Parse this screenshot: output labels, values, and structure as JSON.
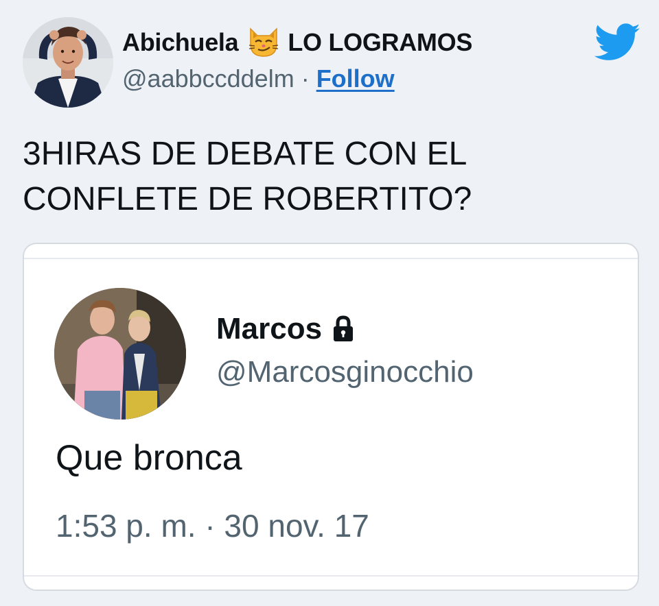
{
  "author": {
    "display_name": "Abichuela",
    "name_emoji": "smirking-cat-emoji",
    "display_name_suffix": "LO LOGRAMOS",
    "handle": "@aabbccddelm",
    "separator": "·",
    "follow_label": "Follow"
  },
  "tweet": {
    "text": "3HIRAS DE DEBATE CON EL\nCONFLETE DE ROBERTITO?"
  },
  "quoted_tweet": {
    "display_name": "Marcos",
    "protected_icon": "lock-icon",
    "handle": "@Marcosginocchio",
    "text": "Que bronca",
    "timestamp": "1:53 p. m. · 30 nov. 17"
  },
  "colors": {
    "background": "#eef1f5",
    "twitter_blue": "#1d9bf0",
    "follow_link": "#1d6fc9",
    "secondary_text": "#536471"
  }
}
